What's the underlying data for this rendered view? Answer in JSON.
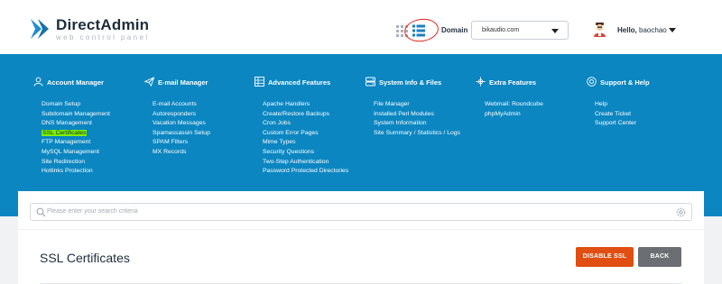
{
  "header": {
    "brand": "DirectAdmin",
    "brand_sub": "web control panel",
    "domain_label": "Domain",
    "domain_value": "bikaudio.com",
    "hello_prefix": "Hello,",
    "username": "baochao"
  },
  "menu": {
    "columns": [
      {
        "title": "Account Manager",
        "icon": "user-icon",
        "items": [
          "Domain Setup",
          "Subdomain Management",
          "DNS Management",
          "SSL Certificates",
          "FTP Management",
          "MySQL Management",
          "Site Redirection",
          "Hotlinks Protection"
        ]
      },
      {
        "title": "E-mail Manager",
        "icon": "paper-plane-icon",
        "items": [
          "E-mail Accounts",
          "Autoresponders",
          "Vacation Messages",
          "Spamassassin Setup",
          "SPAM Filters",
          "MX Records"
        ]
      },
      {
        "title": "Advanced Features",
        "icon": "grid-icon",
        "items": [
          "Apache Handlers",
          "Create/Restore Backups",
          "Cron Jobs",
          "Custom Error Pages",
          "Mime Types",
          "Security Questions",
          "Two-Step Authentication",
          "Password Protected Directories"
        ]
      },
      {
        "title": "System Info & Files",
        "icon": "server-icon",
        "items": [
          "File Manager",
          "Installed Perl Modules",
          "System Information",
          "Site Summary / Statistics / Logs"
        ]
      },
      {
        "title": "Extra Features",
        "icon": "puzzle-icon",
        "items": [
          "Webmail: Roundcube",
          "phpMyAdmin"
        ]
      },
      {
        "title": "Support & Help",
        "icon": "lifebuoy-icon",
        "items": [
          "Help",
          "Create Ticket",
          "Support Center"
        ]
      }
    ],
    "highlighted": "SSL Certificates"
  },
  "search": {
    "placeholder": "Please enter your search criteria"
  },
  "page": {
    "title": "SSL Certificates",
    "disable_label": "DISABLE SSL",
    "back_label": "BACK"
  },
  "colors": {
    "menu_bg": "#0b86c1",
    "highlight": "#7ef000",
    "disable_button": "#e04e12",
    "back_button": "#6b6e72",
    "annotation_circle": "#e0261d"
  }
}
